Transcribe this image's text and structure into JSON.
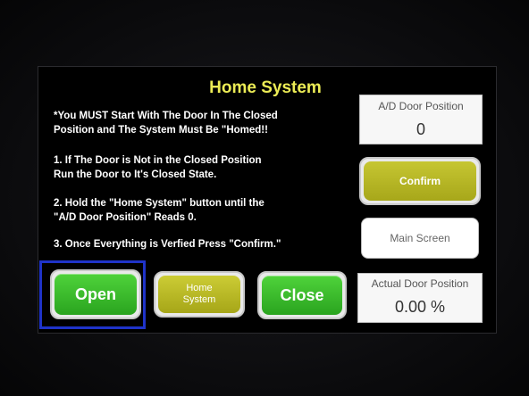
{
  "title": "Home System",
  "instructions": {
    "line1": "*You MUST Start With The Door In The Closed\nPosition and The System Must Be \"Homed!!",
    "line2": "1. If The Door is Not in the Closed Position\nRun the Door to It's Closed State.",
    "line3": "2. Hold the \"Home System\" button until the\n\"A/D Door Position\" Reads 0.",
    "line4": "3. Once Everything is Verfied Press \"Confirm.\""
  },
  "ad_door_position": {
    "label": "A/D Door Position",
    "value": "0"
  },
  "actual_door_position": {
    "label": "Actual Door Position",
    "value": "0.00 %"
  },
  "buttons": {
    "confirm": "Confirm",
    "main_screen": "Main Screen",
    "open": "Open",
    "home_system": "Home\nSystem",
    "close": "Close"
  },
  "colors": {
    "title": "#ecec55",
    "green_button": "#3cc22c",
    "olive_button": "#b8b826",
    "highlight_box": "#1f33c9"
  }
}
